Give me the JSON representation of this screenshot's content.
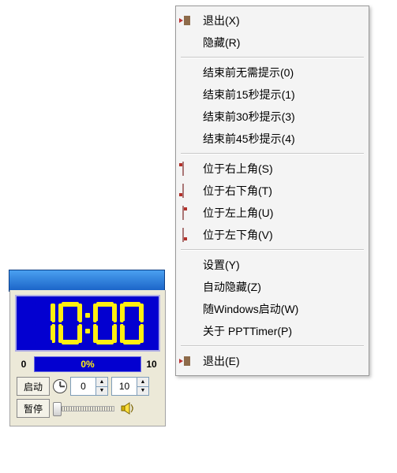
{
  "timer": {
    "display_value": "10:00",
    "digits": [
      "1",
      "0",
      "0",
      "0"
    ],
    "progress_min": "0",
    "progress_max": "10",
    "progress_text": "0%",
    "start_label": "启动",
    "pause_label": "暂停",
    "minute_value": "0",
    "second_value": "10"
  },
  "segment_map": {
    "0": [
      "sa",
      "sb",
      "sc",
      "sd",
      "se",
      "sf"
    ],
    "1": [
      "sb",
      "sc"
    ],
    "2": [
      "sa",
      "sb",
      "sg",
      "se",
      "sd"
    ],
    "3": [
      "sa",
      "sb",
      "sg",
      "sc",
      "sd"
    ],
    "4": [
      "sf",
      "sg",
      "sb",
      "sc"
    ],
    "5": [
      "sa",
      "sf",
      "sg",
      "sc",
      "sd"
    ],
    "6": [
      "sa",
      "sf",
      "sg",
      "se",
      "sc",
      "sd"
    ],
    "7": [
      "sa",
      "sb",
      "sc"
    ],
    "8": [
      "sa",
      "sb",
      "sc",
      "sd",
      "se",
      "sf",
      "sg"
    ],
    "9": [
      "sa",
      "sb",
      "sc",
      "sd",
      "sf",
      "sg"
    ]
  },
  "menu": {
    "items": [
      {
        "label": "退出(X)",
        "icon": "exit",
        "interact": true,
        "name": "menu-exit-x"
      },
      {
        "label": "隐藏(R)",
        "icon": null,
        "interact": true,
        "name": "menu-hide"
      },
      {
        "sep": true
      },
      {
        "label": "结束前无需提示(0)",
        "icon": null,
        "interact": true,
        "name": "menu-remind-0"
      },
      {
        "label": "结束前15秒提示(1)",
        "icon": null,
        "interact": true,
        "name": "menu-remind-15"
      },
      {
        "label": "结束前30秒提示(3)",
        "icon": null,
        "interact": true,
        "name": "menu-remind-30"
      },
      {
        "label": "结束前45秒提示(4)",
        "icon": null,
        "interact": true,
        "name": "menu-remind-45"
      },
      {
        "sep": true
      },
      {
        "label": "位于右上角(S)",
        "icon": "pos-tr",
        "interact": true,
        "name": "menu-pos-tr"
      },
      {
        "label": "位于右下角(T)",
        "icon": "pos-br",
        "interact": true,
        "name": "menu-pos-br"
      },
      {
        "label": "位于左上角(U)",
        "icon": "pos-tl",
        "interact": true,
        "name": "menu-pos-tl"
      },
      {
        "label": "位于左下角(V)",
        "icon": "pos-bl",
        "interact": true,
        "name": "menu-pos-bl"
      },
      {
        "sep": true
      },
      {
        "label": "设置(Y)",
        "icon": null,
        "interact": true,
        "name": "menu-settings"
      },
      {
        "label": "自动隐藏(Z)",
        "icon": null,
        "interact": true,
        "name": "menu-autohide"
      },
      {
        "label": "随Windows启动(W)",
        "icon": null,
        "interact": true,
        "name": "menu-startup"
      },
      {
        "label": "关于 PPTTimer(P)",
        "icon": null,
        "interact": true,
        "name": "menu-about"
      },
      {
        "sep": true
      },
      {
        "label": "退出(E)",
        "icon": "exit",
        "interact": true,
        "name": "menu-exit-e"
      }
    ]
  }
}
